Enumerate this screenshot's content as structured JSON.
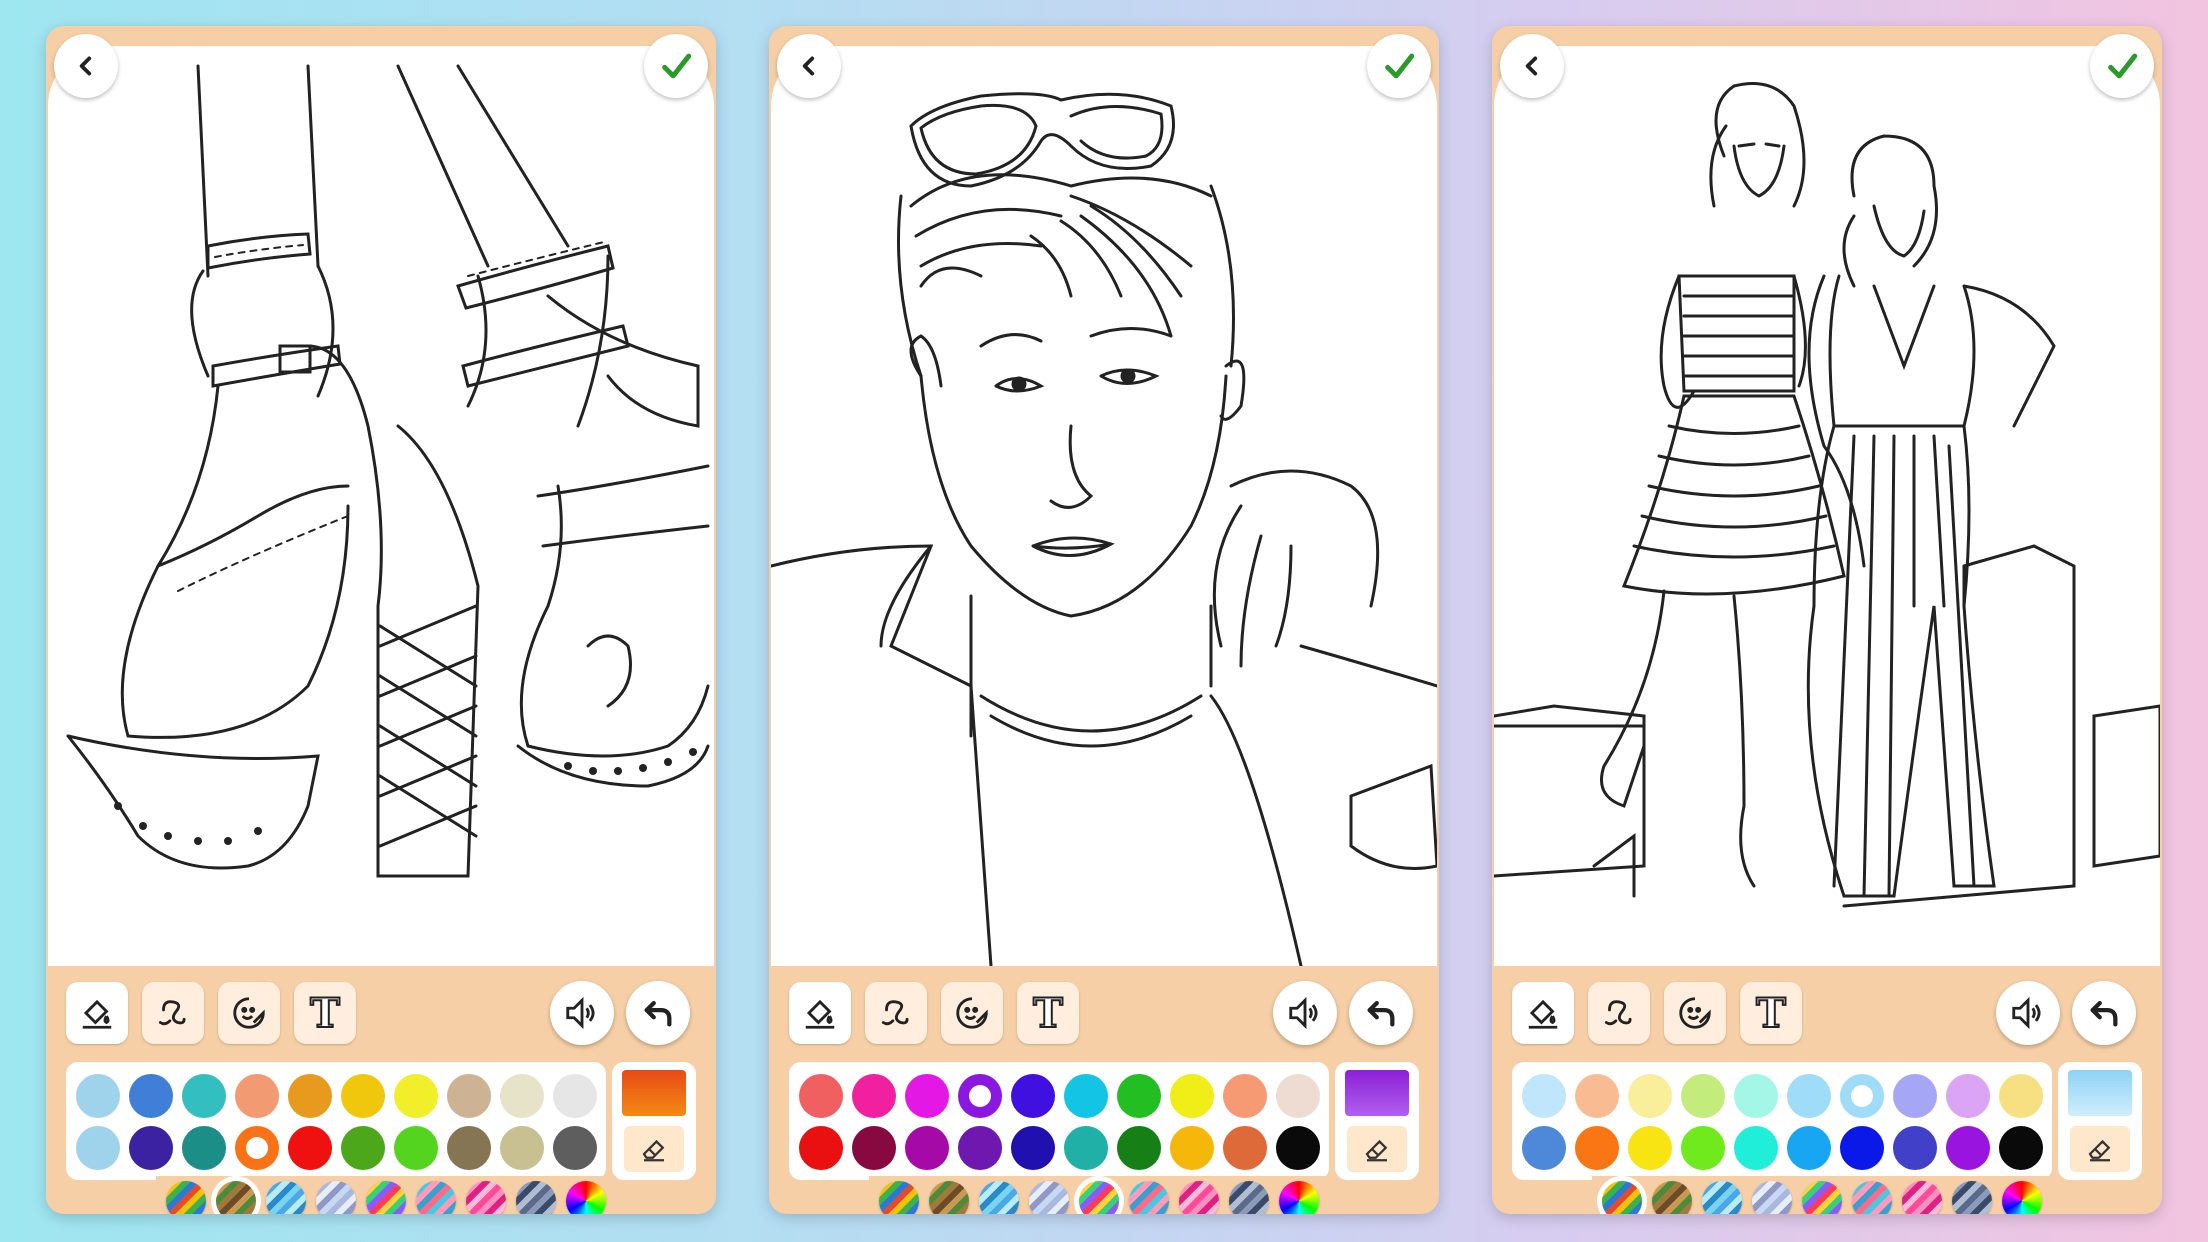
{
  "screens": [
    {
      "id": "shoes",
      "current_color": [
        "#e84a16",
        "#f28a12"
      ],
      "palette": [
        "#9fd3ec",
        "#3f7fd8",
        "#33bfc0",
        "#f29a72",
        "#e79a1e",
        "#f0c70d",
        "#f1ee2a",
        "#cdb294",
        "#e6e3c9",
        "#e6e6e6",
        "#9fd3ec",
        "#3b22a0",
        "#1c8e88",
        "#f97316",
        "#ef1010",
        "#4da71b",
        "#55d41f",
        "#857552",
        "#c8c090",
        "#5e5e5e"
      ],
      "selected_index": 13,
      "selected_set": 1
    },
    {
      "id": "man",
      "current_color": [
        "#8d1fd6",
        "#b060ef"
      ],
      "palette": [
        "#f06060",
        "#f020a0",
        "#e418e4",
        "#8a18e0",
        "#4010e0",
        "#14c4e4",
        "#22be22",
        "#f0ee16",
        "#f59a72",
        "#eedcd2",
        "#e81010",
        "#880840",
        "#a60aa6",
        "#6e18b0",
        "#2010b0",
        "#20b0a8",
        "#168016",
        "#f5b80a",
        "#de6a3a",
        "#0a0a0a"
      ],
      "selected_index": 3,
      "selected_set": 4
    },
    {
      "id": "models",
      "current_color": [
        "#8fd2f5",
        "#cfeefb"
      ],
      "palette": [
        "#bfe6fb",
        "#f9bc92",
        "#f9ee9a",
        "#c2ec7c",
        "#a4f6e6",
        "#9fdcf8",
        "#9fdcf8",
        "#a6a6f6",
        "#dca4f4",
        "#f6e082",
        "#4e88d8",
        "#f97614",
        "#f8e412",
        "#70ea1c",
        "#20eed8",
        "#18a6f2",
        "#0a18e8",
        "#4040c8",
        "#9a14e0",
        "#0a0a0a"
      ],
      "selected_index": 6,
      "selected_set": 0
    }
  ],
  "color_sets": [
    [
      "#e64a2a",
      "#f2c20a",
      "#3bb24a",
      "#2b78d6"
    ],
    [
      "#6e4a2a",
      "#c79a52",
      "#4d8a3a",
      "#a07a3a"
    ],
    [
      "#7ad4f0",
      "#4aa8e8",
      "#b8ecf8",
      "#2a8ac8"
    ],
    [
      "#c8d8f0",
      "#a8b8e0",
      "#e8eef8",
      "#9098c8"
    ],
    [
      "#ff3a5a",
      "#ffd23a",
      "#3ad07a",
      "#8a5aff"
    ],
    [
      "#ff6a8a",
      "#4ac8e0",
      "#ff9aba",
      "#3aa0d0"
    ],
    [
      "#ff4a9a",
      "#ff90c0",
      "#e02080",
      "#ffb8d8"
    ],
    [
      "#5a6a8a",
      "#8a9ab8",
      "#3a4a6a",
      "#b0bcd0"
    ],
    [
      "#ff0000",
      "#00ff00",
      "#0000ff",
      "#ffff00"
    ]
  ],
  "toolbar": {
    "tools": [
      "fill-tool",
      "brush-tool",
      "sticker-tool",
      "text-tool"
    ],
    "text_tool_glyph": "T"
  },
  "icons": [
    "back-arrow-icon",
    "done-check-icon",
    "paint-bucket-icon",
    "brush-squiggle-icon",
    "smiley-sticker-icon",
    "text-icon",
    "sound-icon",
    "undo-icon",
    "eraser-icon"
  ],
  "colors": {
    "panel": "#f6cfa6",
    "check": "#2a9a2a",
    "tool_bg": "#ffeedd"
  }
}
